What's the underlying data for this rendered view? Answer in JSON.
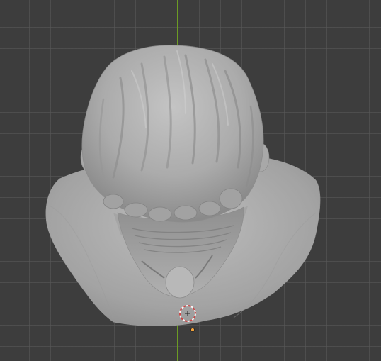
{
  "app": {
    "type": "3d-viewport"
  },
  "viewport": {
    "background_color": "#3d3d3d",
    "grid_color": "#5a5a5a",
    "axis_x_color": "#b23a43",
    "axis_y_color": "#6c9b24"
  },
  "scene": {
    "object": "sculpted-head-bust",
    "mesh_color": "#a9a9a9",
    "view": "top-down"
  },
  "icons": {
    "cursor": "3d-cursor-icon",
    "origin": "object-origin-icon"
  }
}
